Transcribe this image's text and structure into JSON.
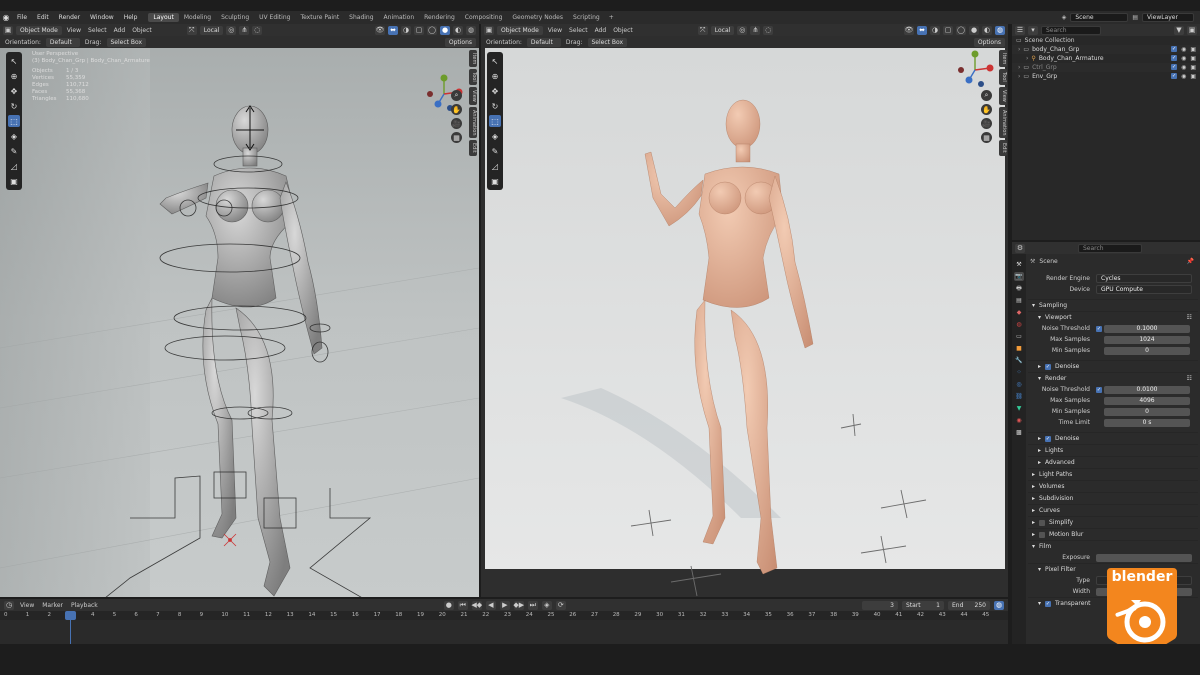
{
  "menu": [
    "File",
    "Edit",
    "Render",
    "Window",
    "Help"
  ],
  "workspaces": [
    "Layout",
    "Modeling",
    "Sculpting",
    "UV Editing",
    "Texture Paint",
    "Shading",
    "Animation",
    "Rendering",
    "Compositing",
    "Geometry Nodes",
    "Scripting"
  ],
  "active_workspace": "Layout",
  "scene_name": "Scene",
  "view_layer": "ViewLayer",
  "viewport_left": {
    "mode": "Object Mode",
    "menus": [
      "View",
      "Select",
      "Add",
      "Object"
    ],
    "orientation_label": "Orientation:",
    "orientation_value": "Default",
    "drag_label": "Drag:",
    "drag_value": "Select Box",
    "transform": "Local",
    "options": "Options",
    "stats": {
      "view": "User Perspective",
      "collection": "(3) Body_Chan_Grp | Body_Chan_Armature",
      "rows": [
        {
          "label": "Objects",
          "value": "1 / 3"
        },
        {
          "label": "Vertices",
          "value": "55,359"
        },
        {
          "label": "Edges",
          "value": "110,712"
        },
        {
          "label": "Faces",
          "value": "55,368"
        },
        {
          "label": "Triangles",
          "value": "110,680"
        }
      ]
    }
  },
  "viewport_right": {
    "mode": "Object Mode",
    "menus": [
      "View",
      "Select",
      "Add",
      "Object"
    ],
    "orientation_label": "Orientation:",
    "orientation_value": "Default",
    "drag_label": "Drag:",
    "drag_value": "Select Box",
    "transform": "Local",
    "options": "Options"
  },
  "side_tabs": [
    "Item",
    "Tool",
    "View",
    "Animation",
    "Edit"
  ],
  "outliner": {
    "search_placeholder": "Search",
    "root": "Scene Collection",
    "items": [
      {
        "name": "body_Chan_Grp",
        "child": false
      },
      {
        "name": "Body_Chan_Armature",
        "child": true
      },
      {
        "name": "Ctrl_Grp",
        "child": false
      },
      {
        "name": "Env_Grp",
        "child": false
      }
    ]
  },
  "properties": {
    "search_placeholder": "Search",
    "context": "Scene",
    "render_engine_label": "Render Engine",
    "render_engine": "Cycles",
    "device_label": "Device",
    "device": "GPU Compute",
    "sampling": "Sampling",
    "viewport": "Viewport",
    "render": "Render",
    "viewport_rows": [
      {
        "label": "Noise Threshold",
        "value": "0.1000",
        "check": true
      },
      {
        "label": "Max Samples",
        "value": "1024",
        "check": false
      },
      {
        "label": "Min Samples",
        "value": "0",
        "check": false
      }
    ],
    "render_rows": [
      {
        "label": "Noise Threshold",
        "value": "0.0100",
        "check": true
      },
      {
        "label": "Max Samples",
        "value": "4096",
        "check": false
      },
      {
        "label": "Min Samples",
        "value": "0",
        "check": false
      },
      {
        "label": "Time Limit",
        "value": "0 s",
        "check": false
      }
    ],
    "denoise": "Denoise",
    "lights": "Lights",
    "advanced": "Advanced",
    "sections": [
      "Light Paths",
      "Volumes",
      "Subdivision",
      "Curves",
      "Simplify",
      "Motion Blur",
      "Film"
    ],
    "exposure_label": "Exposure",
    "pixel_filter": "Pixel Filter",
    "type_label": "Type",
    "width_label": "Width",
    "transparent": "Transparent"
  },
  "timeline": {
    "menus": [
      "View",
      "Marker",
      "Playback"
    ],
    "current_frame": "3",
    "start_label": "Start",
    "start": "1",
    "end_label": "End",
    "end": "250",
    "ruler": [
      "0",
      "1",
      "2",
      "3",
      "4",
      "5",
      "6",
      "7",
      "8",
      "9",
      "10",
      "11",
      "12",
      "13",
      "14",
      "15",
      "16",
      "17",
      "18",
      "19",
      "20",
      "21",
      "22",
      "23",
      "24",
      "25",
      "26",
      "27",
      "28",
      "29",
      "30",
      "31",
      "32",
      "33",
      "34",
      "35",
      "36",
      "37",
      "38",
      "39",
      "40",
      "41",
      "42",
      "43",
      "44",
      "45"
    ]
  },
  "watermark": "blender",
  "colors": {
    "accent": "#4772b3",
    "blender_orange": "#f3861e",
    "skin": "#e2b39a"
  }
}
